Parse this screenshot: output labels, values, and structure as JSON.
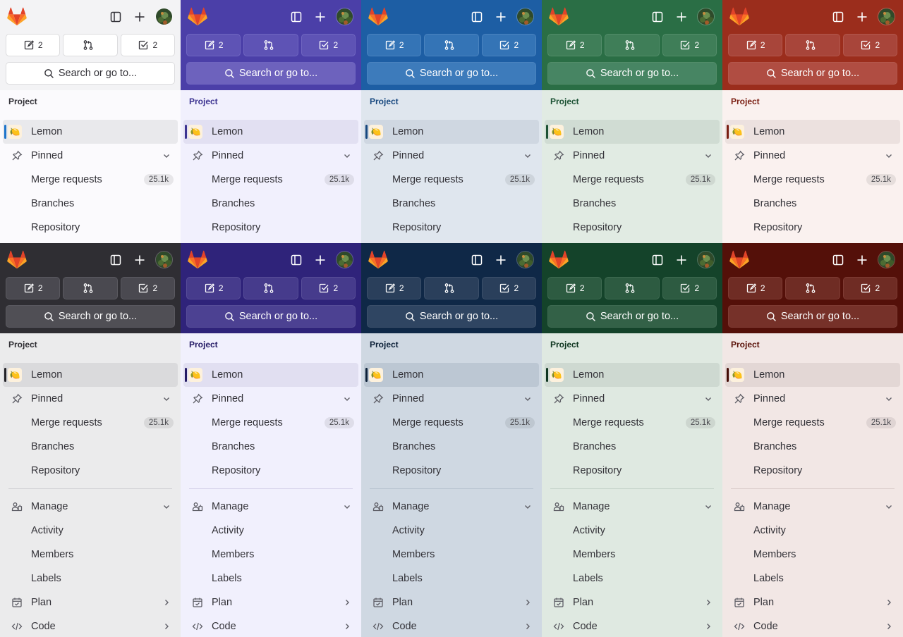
{
  "search_placeholder": "Search or go to...",
  "counts": {
    "issues": "2",
    "merge_requests": "",
    "todos": "2"
  },
  "section_title": "Project",
  "project": {
    "name": "Lemon",
    "avatar_emoji": "🍋"
  },
  "pinned": {
    "label": "Pinned",
    "items": [
      {
        "label": "Merge requests",
        "badge": "25.1k"
      },
      {
        "label": "Branches",
        "badge": ""
      },
      {
        "label": "Repository",
        "badge": ""
      }
    ]
  },
  "manage": {
    "label": "Manage",
    "items": [
      {
        "label": "Activity"
      },
      {
        "label": "Members"
      },
      {
        "label": "Labels"
      }
    ]
  },
  "plan": {
    "label": "Plan"
  },
  "code": {
    "label": "Code"
  },
  "icons": {
    "logo": "gitlab-tanuki-icon",
    "sidebar_toggle": "sidebar-toggle-icon",
    "create": "plus-icon",
    "issues": "issues-icon",
    "merge_requests": "merge-request-icon",
    "todos": "todo-checkbox-icon",
    "search": "search-icon",
    "pin": "pin-icon",
    "manage": "users-icon",
    "plan": "calendar-icon",
    "code": "code-icon",
    "chevron_down": "chevron-down-icon",
    "chevron_right": "chevron-right-icon"
  },
  "themes": [
    {
      "name": "light-indigo-neutral",
      "header_bg": "#f3f3f5",
      "header_fg": "#333238",
      "btn_bg": "#ffffff",
      "btn_border": "#dcdcde",
      "search_bg": "#ffffff",
      "nav_bg": "#fbfafd",
      "active_bg": "#e9e9ec",
      "accent": "#1f75cb",
      "title_color": "#333238",
      "divider": "#dcdcde"
    },
    {
      "name": "indigo",
      "header_bg": "#4b3fa8",
      "header_fg": "#ffffff",
      "btn_bg": "#5e53b5",
      "btn_border": "#6f65c0",
      "search_bg": "#6d62bd",
      "nav_bg": "#f1f0fd",
      "active_bg": "#e2e0f2",
      "accent": "#3c3391",
      "title_color": "#3c3391",
      "divider": "#d6d3ea"
    },
    {
      "name": "blue",
      "header_bg": "#1d5ea4",
      "header_fg": "#ffffff",
      "btn_bg": "#3474b6",
      "btn_border": "#4a83bf",
      "search_bg": "#3d7bbb",
      "nav_bg": "#dfe6ee",
      "active_bg": "#cfd7e1",
      "accent": "#17487f",
      "title_color": "#17487f",
      "divider": "#c7d0dc"
    },
    {
      "name": "green",
      "header_bg": "#2a6e45",
      "header_fg": "#ffffff",
      "btn_bg": "#3f7e58",
      "btn_border": "#528c69",
      "search_bg": "#478563",
      "nav_bg": "#e1ebe3",
      "active_bg": "#d0dcd3",
      "accent": "#1c5234",
      "title_color": "#1c5234",
      "divider": "#c8d6cc"
    },
    {
      "name": "red",
      "header_bg": "#9b2d1c",
      "header_fg": "#ffffff",
      "btn_bg": "#a8453a",
      "btn_border": "#b4574c",
      "search_bg": "#b04d42",
      "nav_bg": "#faf1ef",
      "active_bg": "#ece1df",
      "accent": "#7a1e12",
      "title_color": "#7a1e12",
      "divider": "#e4d6d3"
    },
    {
      "name": "dark-neutral",
      "header_bg": "#2f2e33",
      "header_fg": "#ffffff",
      "btn_bg": "#4a4950",
      "btn_border": "#5a5960",
      "search_bg": "#504f55",
      "nav_bg": "#ebebec",
      "active_bg": "#dadadc",
      "accent": "#232227",
      "title_color": "#2f2e33",
      "divider": "#d2d2d5"
    },
    {
      "name": "dark-indigo",
      "header_bg": "#2f237a",
      "header_fg": "#ffffff",
      "btn_bg": "#463b8c",
      "btn_border": "#574d98",
      "search_bg": "#4c4192",
      "nav_bg": "#f1f0fd",
      "active_bg": "#e1dff1",
      "accent": "#251b66",
      "title_color": "#251b66",
      "divider": "#d6d3ea"
    },
    {
      "name": "dark-blue",
      "header_bg": "#0f2847",
      "header_fg": "#ffffff",
      "btn_bg": "#2a3f5b",
      "btn_border": "#3b4f69",
      "search_bg": "#2f4562",
      "nav_bg": "#cfd8e2",
      "active_bg": "#bcc7d3",
      "accent": "#0c2038",
      "title_color": "#0c2038",
      "divider": "#b9c4d1"
    },
    {
      "name": "dark-green",
      "header_bg": "#14432a",
      "header_fg": "#ffffff",
      "btn_bg": "#2d5b41",
      "btn_border": "#3d6950",
      "search_bg": "#336147",
      "nav_bg": "#dfe9e1",
      "active_bg": "#ced9d1",
      "accent": "#0f3620",
      "title_color": "#0f3620",
      "divider": "#c6d4ca"
    },
    {
      "name": "dark-red",
      "header_bg": "#541009",
      "header_fg": "#ffffff",
      "btn_bg": "#6f2c24",
      "btn_border": "#7e3b33",
      "search_bg": "#763129",
      "nav_bg": "#f2e7e5",
      "active_bg": "#e3d7d5",
      "accent": "#440c06",
      "title_color": "#5a1108",
      "divider": "#dbcecc"
    }
  ]
}
